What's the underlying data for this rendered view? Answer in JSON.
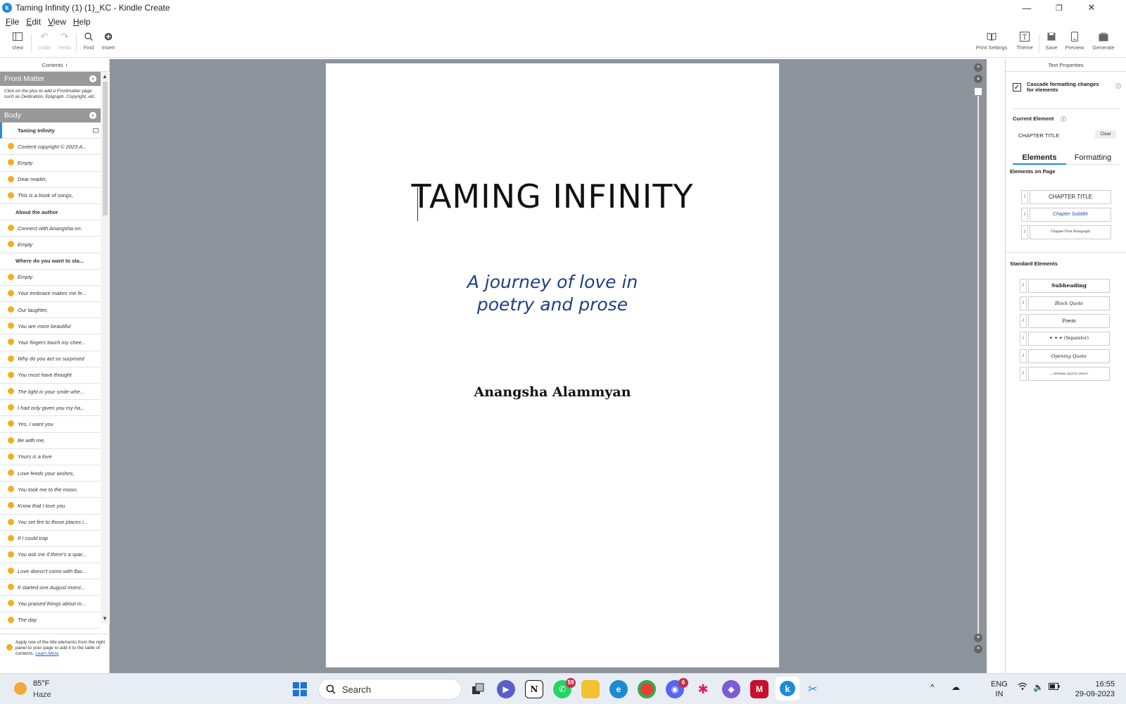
{
  "window": {
    "title": "Taming Infinity (1) (1)_KC - Kindle Create",
    "app_icon": "k",
    "minimize": "—",
    "maximize": "❐",
    "close": "✕"
  },
  "menu": [
    "File",
    "Edit",
    "View",
    "Help"
  ],
  "toolbar": {
    "left": [
      {
        "label": "View",
        "icon": "view-icon"
      },
      {
        "label": "Undo",
        "icon": "undo-icon"
      },
      {
        "label": "Redo",
        "icon": "redo-icon"
      },
      {
        "label": "Find",
        "icon": "search-icon"
      },
      {
        "label": "Insert",
        "icon": "plus-circle-icon"
      }
    ],
    "right": [
      {
        "label": "Print Settings",
        "icon": "book-icon"
      },
      {
        "label": "Theme",
        "icon": "theme-icon"
      },
      {
        "label": "Save",
        "icon": "save-icon"
      },
      {
        "label": "Preview",
        "icon": "device-icon"
      },
      {
        "label": "Generate",
        "icon": "package-icon"
      }
    ]
  },
  "contents": {
    "header": "Contents",
    "info": "i",
    "front_matter": "Front Matter",
    "front_matter_note": "Click on the plus to add a Frontmatter page such as Dedication, Epigraph, Copyright, etc.",
    "body": "Body",
    "items": [
      {
        "text": "Taming Infinity",
        "type": "heading",
        "selected": true
      },
      {
        "text": "Content copyright © 2023 A...",
        "type": "item"
      },
      {
        "text": "Empty",
        "type": "item"
      },
      {
        "text": "Dear reader,",
        "type": "item"
      },
      {
        "text": "This is a book of songs,",
        "type": "item"
      },
      {
        "text": "About the author",
        "type": "heading"
      },
      {
        "text": "Connect with Anangsha on:",
        "type": "item"
      },
      {
        "text": "Empty",
        "type": "item"
      },
      {
        "text": "Where do you want to sta...",
        "type": "heading"
      },
      {
        "text": "Empty",
        "type": "item"
      },
      {
        "text": "Your embrace makes me fe...",
        "type": "item"
      },
      {
        "text": "Our laughter,",
        "type": "item"
      },
      {
        "text": "You are more beautiful",
        "type": "item"
      },
      {
        "text": "Your fingers touch my chee...",
        "type": "item"
      },
      {
        "text": "Why do you act so surprised",
        "type": "item"
      },
      {
        "text": "You must have thought",
        "type": "item"
      },
      {
        "text": "The light in your smile whe...",
        "type": "item"
      },
      {
        "text": "I had only given you my ha...",
        "type": "item"
      },
      {
        "text": "Yes, I want you",
        "type": "item"
      },
      {
        "text": "Be with me,",
        "type": "item"
      },
      {
        "text": "Yours is a love",
        "type": "item"
      },
      {
        "text": "Love feeds your wishes,",
        "type": "item"
      },
      {
        "text": "You took me to the moon,",
        "type": "item"
      },
      {
        "text": "Know that I love you",
        "type": "item"
      },
      {
        "text": "You set fire to those places i...",
        "type": "item"
      },
      {
        "text": "If I could trap",
        "type": "item"
      },
      {
        "text": "You ask me if there's a spar...",
        "type": "item"
      },
      {
        "text": "Love doesn't come with flas...",
        "type": "item"
      },
      {
        "text": "It started one August morni...",
        "type": "item"
      },
      {
        "text": "You praised things about m...",
        "type": "item"
      },
      {
        "text": "The day",
        "type": "item"
      }
    ],
    "footer_text": "Apply one of the title elements from the right panel to your page to add it to the table of contents.",
    "footer_link": "Learn More"
  },
  "document": {
    "title": "TAMING INFINITY",
    "subtitle_line1": "A journey of love in",
    "subtitle_line2": "poetry and prose",
    "author": "Anangsha Alammyan"
  },
  "text_properties": {
    "header": "Text Properties",
    "cascade_checked": true,
    "cascade_label": "Cascade formatting changes for elements",
    "current_element_label": "Current Element",
    "current_element_value": "CHAPTER TITLE",
    "clear_label": "Clear",
    "tabs": [
      "Elements",
      "Formatting"
    ],
    "active_tab": "Elements",
    "elements_on_page_label": "Elements on Page",
    "elements_on_page": [
      "CHAPTER TITLE",
      "Chapter Subtitle",
      "Chapter First Paragraph"
    ],
    "standard_elements_label": "Standard Elements",
    "standard_elements": [
      "Subheading",
      "Block Quote",
      "Poem",
      "✦ ✦ ✦   (Separator)",
      "Opening Quote",
      "— OPENING QUOTE CREDIT"
    ]
  },
  "taskbar": {
    "weather_temp": "85°F",
    "weather_desc": "Haze",
    "search_placeholder": "Search",
    "whatsapp_badge": "59",
    "discord_badge": "6",
    "lang_line1": "ENG",
    "lang_line2": "IN",
    "time": "16:55",
    "date": "29-09-2023"
  }
}
